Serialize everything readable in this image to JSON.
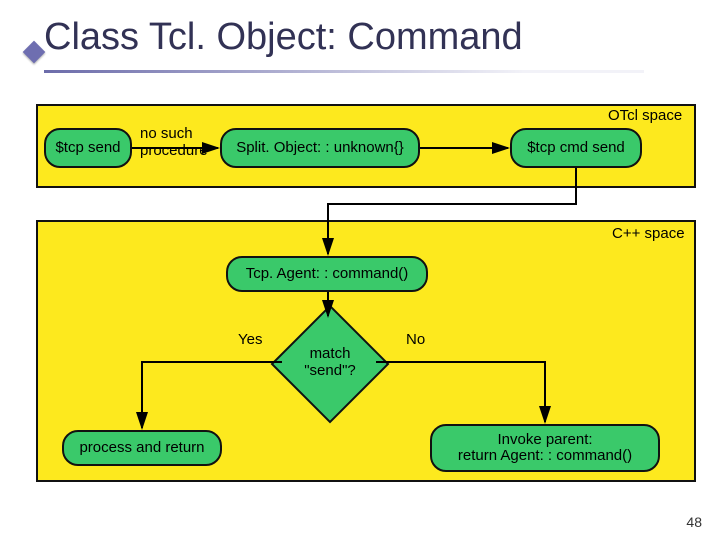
{
  "title": "Class Tcl. Object: Command",
  "panel_top_label": "OTcl space",
  "panel_bot_label": "C++ space",
  "node_tcp_send": "$tcp send",
  "node_split_unknown": "Split. Object: : unknown{}",
  "node_tcp_cmd_send": "$tcp cmd send",
  "edge_no_such_line1": "no such",
  "edge_no_such_line2": "procedure",
  "node_tcpagent_cmd": "Tcp. Agent: : command()",
  "diamond_line1": "match",
  "diamond_line2": "\"send\"?",
  "edge_yes": "Yes",
  "edge_no": "No",
  "node_process_return": "process and return",
  "node_invoke_line1": "Invoke parent:",
  "node_invoke_line2": "return Agent: : command()",
  "slide_number": "48"
}
